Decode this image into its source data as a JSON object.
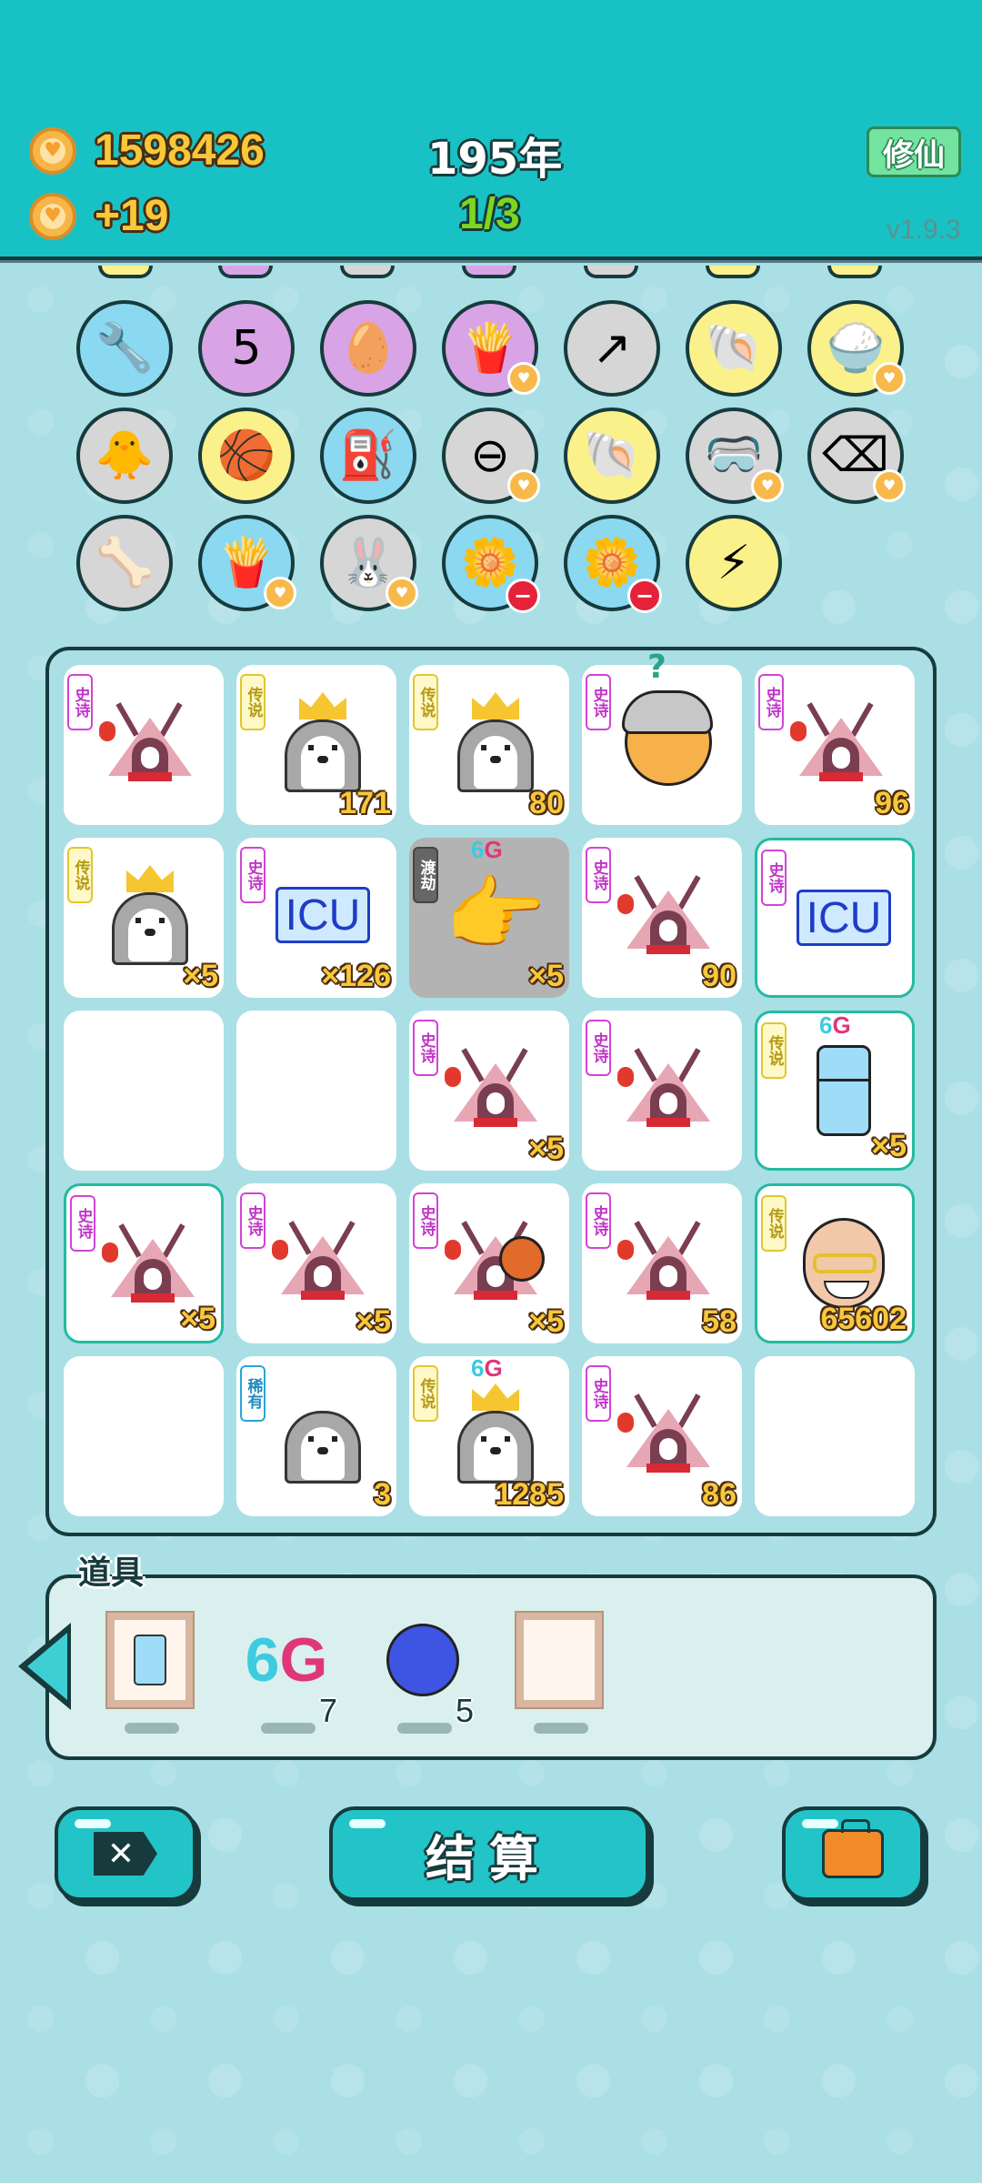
{
  "header": {
    "coins": "1598426",
    "income": "+19",
    "year": "195年",
    "round": "1/3",
    "mode_button": "修仙",
    "version": "v1.9.3"
  },
  "relics": [
    {
      "name": "shield-wrench-icon",
      "glyph": "🔧",
      "bg": "blue"
    },
    {
      "name": "calendar-icon",
      "glyph": "5",
      "bg": "purple"
    },
    {
      "name": "egg-icon",
      "glyph": "🥚",
      "bg": "purple"
    },
    {
      "name": "fries-icon",
      "glyph": "🍟",
      "bg": "purple",
      "heart": true
    },
    {
      "name": "upgrade-arrow-icon",
      "glyph": "↗",
      "bg": "grey"
    },
    {
      "name": "shell-icon",
      "glyph": "🐚",
      "bg": "yellow"
    },
    {
      "name": "rice-bowl-icon",
      "glyph": "🍚",
      "bg": "yellow",
      "heart": true
    },
    {
      "name": "chick-egg-icon",
      "glyph": "🐥",
      "bg": "grey"
    },
    {
      "name": "basketballs-icon",
      "glyph": "🏀",
      "bg": "yellow"
    },
    {
      "name": "pump-icon",
      "glyph": "⛽",
      "bg": "blue"
    },
    {
      "name": "minus-circle-icon",
      "glyph": "⊖",
      "bg": "grey",
      "heart": true
    },
    {
      "name": "shell-icon",
      "glyph": "🐚",
      "bg": "yellow"
    },
    {
      "name": "goggles-icon",
      "glyph": "🥽",
      "bg": "grey",
      "heart": true
    },
    {
      "name": "delete-tag-icon",
      "glyph": "⌫",
      "bg": "grey",
      "heart": true
    },
    {
      "name": "pet-bowl-icon",
      "glyph": "🦴",
      "bg": "grey"
    },
    {
      "name": "fries-icon",
      "glyph": "🍟",
      "bg": "blue",
      "heart": true
    },
    {
      "name": "rabbit-icon",
      "glyph": "🐰",
      "bg": "grey",
      "heart": true
    },
    {
      "name": "potted-flower-icon",
      "glyph": "🌼",
      "bg": "blue",
      "minus": true
    },
    {
      "name": "potted-flower-icon",
      "glyph": "🌼",
      "bg": "blue",
      "minus": true
    },
    {
      "name": "lightning-icon",
      "glyph": "⚡",
      "bg": "yellow"
    }
  ],
  "rarity_labels": {
    "epic": "史诗",
    "legend": "传说",
    "rare": "稀有",
    "trial": "渡劫"
  },
  "board": [
    {
      "tag": "epic",
      "art": "tent",
      "num": ""
    },
    {
      "tag": "legend",
      "art": "husky-crown-ice",
      "num": "171"
    },
    {
      "tag": "legend",
      "art": "husky-crown",
      "num": "80"
    },
    {
      "tag": "epic",
      "art": "chick-hair",
      "num": "",
      "question": "?"
    },
    {
      "tag": "epic",
      "art": "tent",
      "num": "96"
    },
    {
      "tag": "legend",
      "art": "husky-crown",
      "num": "×5"
    },
    {
      "tag": "epic",
      "art": "icu",
      "num": "×126"
    },
    {
      "tag": "trial",
      "art": "hand",
      "num": "×5",
      "sixg": true,
      "grey": true
    },
    {
      "tag": "epic",
      "art": "tent",
      "num": "90"
    },
    {
      "tag": "epic",
      "art": "icu",
      "num": "",
      "hl": true
    },
    {
      "tag": "",
      "art": "",
      "num": ""
    },
    {
      "tag": "",
      "art": "",
      "num": ""
    },
    {
      "tag": "epic",
      "art": "tent",
      "num": "×5"
    },
    {
      "tag": "epic",
      "art": "tent",
      "num": ""
    },
    {
      "tag": "legend",
      "art": "fridge",
      "num": "×5",
      "sixg": true,
      "hl": true
    },
    {
      "tag": "epic",
      "art": "tent",
      "num": "×5",
      "hl": true
    },
    {
      "tag": "epic",
      "art": "tent",
      "num": "×5"
    },
    {
      "tag": "epic",
      "art": "tent-ball",
      "num": "×5"
    },
    {
      "tag": "epic",
      "art": "tent",
      "num": "58"
    },
    {
      "tag": "legend",
      "art": "baldy",
      "num": "65602",
      "hl": true
    },
    {
      "tag": "",
      "art": "",
      "num": ""
    },
    {
      "tag": "rare",
      "art": "husky",
      "num": "3"
    },
    {
      "tag": "legend",
      "art": "husky-crown",
      "num": "1285",
      "sixg": true
    },
    {
      "tag": "epic",
      "art": "tent",
      "num": "86"
    },
    {
      "tag": "",
      "art": "",
      "num": ""
    }
  ],
  "sixg": {
    "six": "6",
    "g": "G"
  },
  "icu_text": "ICU",
  "props": {
    "title": "道具",
    "items": [
      {
        "name": "fridge-frame-item",
        "count": ""
      },
      {
        "name": "6g-item",
        "count": "7"
      },
      {
        "name": "blueberry-item",
        "count": "5"
      },
      {
        "name": "empty-frame-item",
        "count": ""
      }
    ]
  },
  "actions": {
    "settle_label": "结算",
    "close_symbol": "✕"
  }
}
